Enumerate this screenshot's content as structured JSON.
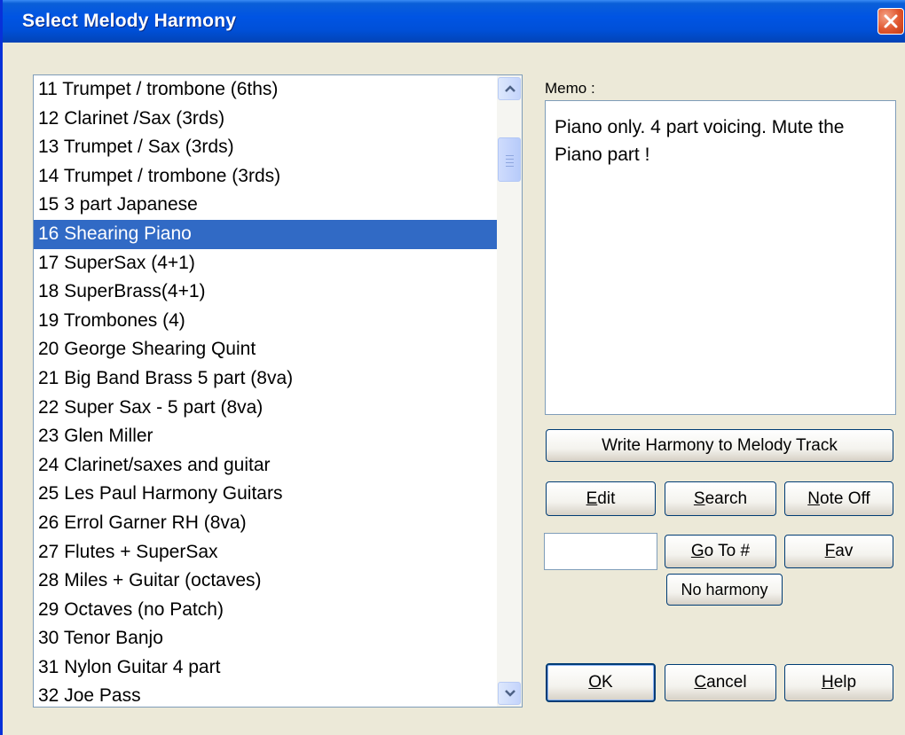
{
  "window": {
    "title": "Select Melody Harmony"
  },
  "list": {
    "items": [
      "11 Trumpet / trombone (6ths)",
      "12 Clarinet /Sax (3rds)",
      "13 Trumpet / Sax (3rds)",
      "14 Trumpet / trombone (3rds)",
      "15 3 part Japanese",
      "16 Shearing Piano",
      "17 SuperSax (4+1)",
      "18 SuperBrass(4+1)",
      "19 Trombones (4)",
      "20 George Shearing Quint",
      "21 Big Band Brass 5 part (8va)",
      "22 Super Sax - 5 part (8va)",
      "23 Glen Miller",
      "24 Clarinet/saxes and guitar",
      "25 Les Paul Harmony Guitars",
      "26 Errol Garner RH (8va)",
      "27 Flutes + SuperSax",
      "28 Miles + Guitar (octaves)",
      "29 Octaves (no Patch)",
      "30 Tenor Banjo",
      "31 Nylon Guitar 4 part",
      "32 Joe Pass"
    ],
    "selected_index": 5
  },
  "memo": {
    "label": "Memo :",
    "text": "Piano only. 4 part voicing. Mute the Piano part !"
  },
  "buttons": {
    "write_harmony": "Write Harmony to Melody Track",
    "edit_first": "E",
    "edit_rest": "dit",
    "search_first": "S",
    "search_rest": "earch",
    "note_off_first": "N",
    "note_off_rest": "ote Off",
    "goto_first": "G",
    "goto_rest": "o To #",
    "fav_first": "F",
    "fav_rest": "av",
    "no_harmony": "No harmony",
    "ok_first": "O",
    "ok_rest": "K",
    "cancel_first": "C",
    "cancel_rest": "ancel",
    "help_first": "H",
    "help_rest": "elp"
  },
  "goto": {
    "value": ""
  },
  "icons": {
    "close": "close-icon",
    "scroll_up": "scroll-up-arrow-icon",
    "scroll_down": "scroll-down-arrow-icon"
  },
  "colors": {
    "title_bar": "#0054e3",
    "selection": "#316ac5",
    "dialog_bg": "#ece9d8",
    "close_button": "#e0562e"
  }
}
